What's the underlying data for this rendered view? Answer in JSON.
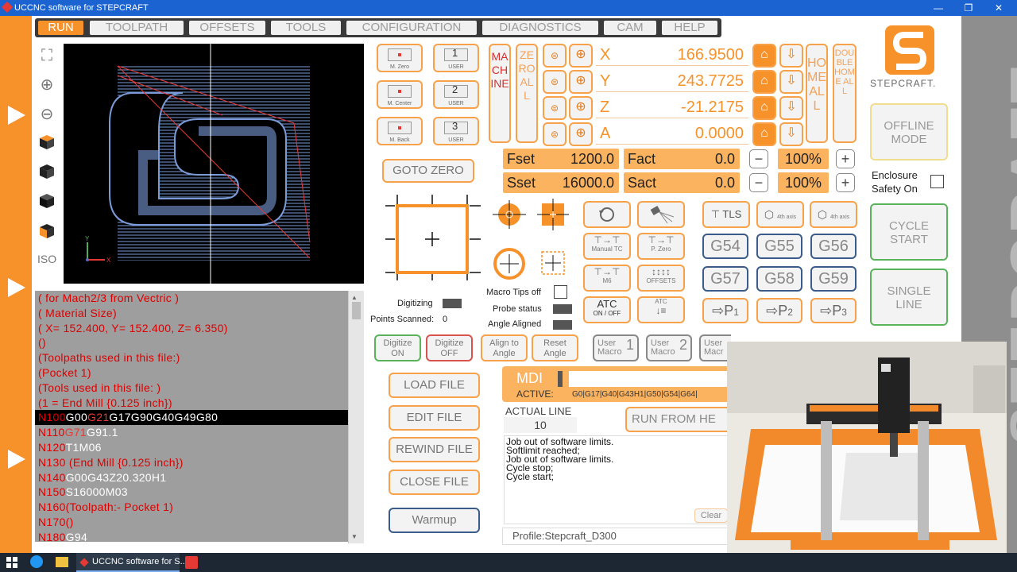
{
  "window": {
    "title": "UCCNC software for STEPCRAFT",
    "min": "—",
    "max": "❐",
    "close": "✕"
  },
  "tabs": [
    "RUN",
    "TOOLPATH",
    "OFFSETS",
    "TOOLS",
    "CONFIGURATION",
    "DIAGNOSTICS",
    "CAM",
    "HELP"
  ],
  "side_icons": {
    "fit": "⛶",
    "zoom_in": "⊕",
    "zoom_out": "⊖",
    "iso": "ISO"
  },
  "viewer": {
    "axis_x": "X",
    "axis_y": "Y"
  },
  "code_lines": [
    {
      "n": "",
      "text": "( for Mach2/3 from Vectric )"
    },
    {
      "n": "",
      "text": "( Material Size)"
    },
    {
      "n": "",
      "text": "( X= 152.400, Y= 152.400, Z= 6.350)"
    },
    {
      "n": "",
      "text": "()"
    },
    {
      "n": "",
      "text": "(Toolpaths used in this file:)"
    },
    {
      "n": "",
      "text": "(Pocket 1)"
    },
    {
      "n": "",
      "text": "(Tools used in this file: )"
    },
    {
      "n": "",
      "text": "(1 = End Mill {0.125 inch})"
    },
    {
      "n": "N100",
      "a": "G00",
      "b": "G21",
      "c": "G17G90G40G49G80",
      "sel": true
    },
    {
      "n": "N110",
      "a": "",
      "b": "G71",
      "c": "G91.1"
    },
    {
      "n": "N120",
      "a": "",
      "b": "",
      "c": "T1M06"
    },
    {
      "n": "N130",
      "a": "",
      "b": "",
      "c": "",
      "r": " (End Mill {0.125 inch})"
    },
    {
      "n": "N140",
      "a": "",
      "b": "",
      "c": "G00G43Z20.320H1"
    },
    {
      "n": "N150",
      "a": "",
      "b": "",
      "c": "S16000M03"
    },
    {
      "n": "N160",
      "a": "",
      "b": "",
      "c": "",
      "r": "(Toolpath:- Pocket 1)"
    },
    {
      "n": "N170",
      "a": "",
      "b": "",
      "c": "",
      "r": "()"
    },
    {
      "n": "N180",
      "a": "",
      "b": "",
      "c": "G94"
    }
  ],
  "zero_buttons": [
    {
      "num": "",
      "label": "M. Zero"
    },
    {
      "num": "1",
      "label": "USER"
    },
    {
      "num": "",
      "label": "M. Center"
    },
    {
      "num": "2",
      "label": "USER"
    },
    {
      "num": "",
      "label": "M. Back"
    },
    {
      "num": "3",
      "label": "USER"
    }
  ],
  "machine_label": "MACHINE",
  "zero_all_label": "ZERO ALL",
  "home_all_label": "HOME ALL",
  "double_home_label": "DOUBLE HOME ALL",
  "axes": [
    {
      "name": "X",
      "value": "166.9500"
    },
    {
      "name": "Y",
      "value": "243.7725"
    },
    {
      "name": "Z",
      "value": "-21.2175"
    },
    {
      "name": "A",
      "value": "0.0000"
    }
  ],
  "feeds": {
    "fset_label": "Fset",
    "fset": "1200.0",
    "fact_label": "Fact",
    "fact": "0.0",
    "fpct": "100%",
    "sset_label": "Sset",
    "sset": "16000.0",
    "sact_label": "Sact",
    "sact": "0.0",
    "spct": "100%",
    "minus": "−",
    "plus": "+"
  },
  "goto_zero": "GOTO ZERO",
  "tool_buttons": {
    "tls": "TLS",
    "manual_tc": "Manual TC",
    "pzero": "P. Zero",
    "m6": "M6",
    "offsets": "OFFSETS",
    "atc": "ATC",
    "atc_sub": "ON / OFF",
    "atc2": "ATC",
    "axis4a": "4th axis Center",
    "axis4b": "4th axis Center"
  },
  "g_codes": [
    "G54",
    "G55",
    "G56",
    "G57",
    "G58",
    "G59"
  ],
  "p_buttons": [
    {
      "p": "P",
      "sub": "1"
    },
    {
      "p": "P",
      "sub": "2"
    },
    {
      "p": "P",
      "sub": "3"
    }
  ],
  "probe": {
    "macro_tips": "Macro Tips off",
    "digitizing": "Digitizing",
    "probe_status": "Probe status",
    "points_scanned_label": "Points Scanned:",
    "points_scanned": "0",
    "angle_aligned": "Angle Aligned"
  },
  "digitize_buttons": [
    {
      "label": "Digitize",
      "sub": "ON"
    },
    {
      "label": "Digitize",
      "sub": "OFF"
    },
    {
      "label": "Align to",
      "sub": "Angle"
    },
    {
      "label": "Reset",
      "sub": "Angle"
    }
  ],
  "user_macros": [
    {
      "label": "User",
      "sub": "Macro",
      "num": "1"
    },
    {
      "label": "User",
      "sub": "Macro",
      "num": "2"
    },
    {
      "label": "User",
      "sub": "Macr",
      "num": ""
    }
  ],
  "file_buttons": [
    "LOAD FILE",
    "EDIT FILE",
    "REWIND FILE",
    "CLOSE FILE",
    "Warmup"
  ],
  "mdi": {
    "label": "MDI",
    "active_label": "ACTIVE:",
    "active": "G0|G17|G40|G43H1|G50|G54|G64|"
  },
  "actual_line": {
    "label": "ACTUAL LINE",
    "value": "10"
  },
  "run_from_here": "RUN FROM HE",
  "log": [
    "Job out of software limits.",
    "Softlimit reached;",
    "Job out of software limits.",
    "Cycle stop;",
    "Cycle start;"
  ],
  "clear": "Clear",
  "profile": "Profile:Stepcraft_D300",
  "brand": "STEPCRAFT.",
  "watermark": "STEPCRAFT.",
  "right_buttons": {
    "offline": "OFFLINE MODE",
    "enclosure": "Enclosure Safety On",
    "cycle_start": "CYCLE START",
    "single_line": "SINGLE LINE"
  },
  "taskbar": {
    "app": "UCCNC software for S...",
    "search": "⌕"
  },
  "colors": {
    "orange": "#f7922a",
    "title": "#1a63d0",
    "taskbar": "#1c2733"
  }
}
